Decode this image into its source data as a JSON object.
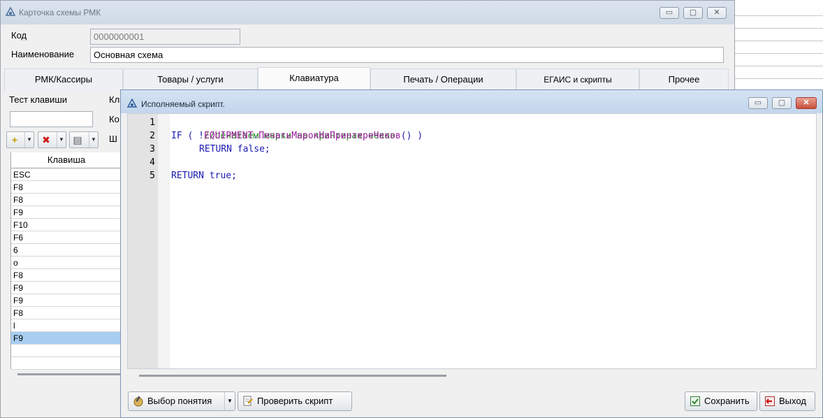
{
  "background": {},
  "main_window": {
    "title": "Карточка схемы РМК",
    "controls": {
      "minimize": "▭",
      "maximize": "▢",
      "close": "✕"
    },
    "code_label": "Код",
    "code_value": "0000000001",
    "name_label": "Наименование",
    "name_value": "Основная схема",
    "tabs": [
      {
        "label": "РМК/Кассиры"
      },
      {
        "label": "Товары / услуги"
      },
      {
        "label": "Клавиатура"
      },
      {
        "label": "Печать / Операции"
      },
      {
        "label": "ЕГАИС и скрипты"
      },
      {
        "label": "Прочее"
      }
    ],
    "test_key_label": "Тест клавиши",
    "partial_labels": [
      "Кл",
      "Ко",
      "Ш"
    ],
    "toolbar": {
      "add_icon": "+",
      "delete_icon": "✖",
      "print_icon": "▤",
      "dropdown": "▼"
    },
    "grid": {
      "header": "Клавиша",
      "rows": [
        "ESC",
        "F8",
        "F8",
        "F9",
        "F10",
        "F6",
        "6",
        "o",
        "F8",
        "F9",
        "F9",
        "F8",
        "l",
        "F9"
      ],
      "selected_row_index": 13
    }
  },
  "script_dialog": {
    "title": "Исполняемый скрипт.",
    "controls": {
      "minimize": "▭",
      "maximize": "▢",
      "close": "✕"
    },
    "line_numbers": [
      "1",
      "2",
      "3",
      "4",
      "5"
    ],
    "code": {
      "line1_comment": "//печатаем марки на принтерах чеков",
      "line2_if": "IF",
      "line2_open": " ( !",
      "line2_obj": "EQUIPMENT",
      "line2_dot": ".",
      "line2_method": "ПечатьМарокНаПринтереЧеков",
      "line2_close": "() )",
      "line3_return": "RETURN",
      "line3_value": " false;",
      "line5_return": "RETURN",
      "line5_value": " true;"
    },
    "buttons": {
      "choose_concept": "Выбор понятия",
      "check_script": "Проверить скрипт",
      "save": "Сохранить",
      "exit": "Выход"
    }
  }
}
